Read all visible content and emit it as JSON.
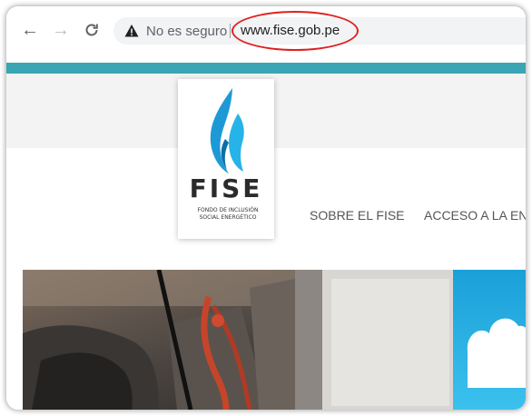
{
  "browser": {
    "back_icon": "arrow-left-icon",
    "forward_icon": "arrow-right-icon",
    "reload_icon": "reload-icon",
    "security_icon": "warning-triangle-icon",
    "security_text": "No es seguro",
    "url": "www.fise.gob.pe",
    "highlight_color": "#e02020"
  },
  "site": {
    "brand_color": "#3aa5b3",
    "logo": {
      "name": "FISE",
      "tagline_line1": "FONDO DE INCLUSIÓN",
      "tagline_line2": "SOCIAL ENERGÉTICO"
    },
    "menu": [
      {
        "label": "SOBRE EL FISE"
      },
      {
        "label": "ACCESO A LA EN"
      }
    ]
  }
}
